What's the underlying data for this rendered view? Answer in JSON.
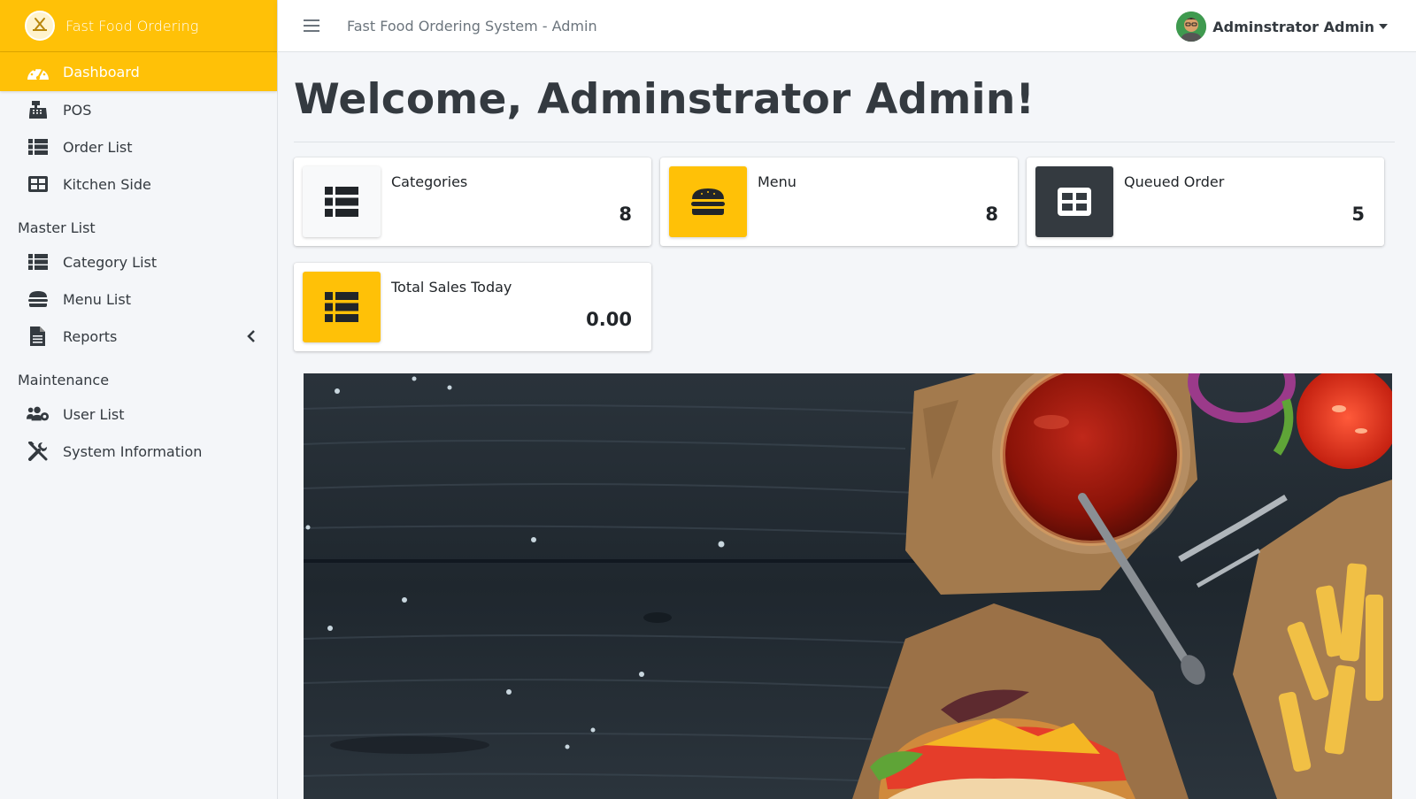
{
  "brand": {
    "title": "Fast Food Ordering",
    "logo_icon": "restaurant-logo-icon"
  },
  "topbar": {
    "title": "Fast Food Ordering System - Admin",
    "user_name": "Adminstrator Admin"
  },
  "sidebar": {
    "items": [
      {
        "label": "Dashboard",
        "icon": "dashboard-gauge-icon",
        "active": true
      },
      {
        "label": "POS",
        "icon": "cash-register-icon"
      },
      {
        "label": "Order List",
        "icon": "list-icon"
      },
      {
        "label": "Kitchen Side",
        "icon": "th-large-icon"
      }
    ],
    "master_header": "Master List",
    "master_items": [
      {
        "label": "Category List",
        "icon": "list-icon"
      },
      {
        "label": "Menu List",
        "icon": "hamburger-icon"
      },
      {
        "label": "Reports",
        "icon": "file-alt-icon"
      }
    ],
    "maintenance_header": "Maintenance",
    "maintenance_items": [
      {
        "label": "User List",
        "icon": "users-cog-icon"
      },
      {
        "label": "System Information",
        "icon": "tools-icon"
      }
    ]
  },
  "main": {
    "welcome": "Welcome, Adminstrator Admin!",
    "stats": [
      {
        "label": "Categories",
        "value": "8",
        "icon": "list-icon",
        "color": "#f8f9fa"
      },
      {
        "label": "Menu",
        "value": "8",
        "icon": "hamburger-icon",
        "color": "#ffc107"
      },
      {
        "label": "Queued Order",
        "value": "5",
        "icon": "th-large-icon",
        "color": "#343a40"
      },
      {
        "label": "Total Sales Today",
        "value": "0.00",
        "icon": "list-icon",
        "color": "#ffc107"
      }
    ]
  },
  "colors": {
    "accent": "#ffc107",
    "dark": "#343a40",
    "background": "#f4f6f9"
  }
}
